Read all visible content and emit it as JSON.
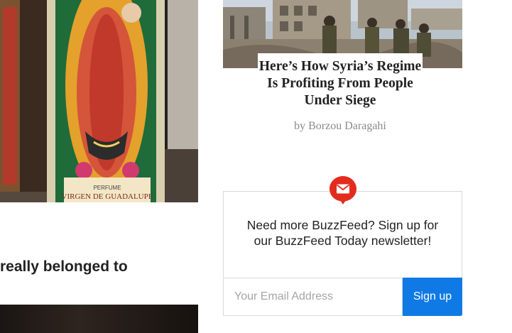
{
  "left_column": {
    "headline_fragment": "really belonged to",
    "candle_label_text": "VIRGEN DE GUADALUPE",
    "candle_tag_text": "PERFUME"
  },
  "story": {
    "title": "Here’s How Syria’s Regime Is Profiting From People Under Siege",
    "byline": "by Borzou Daragahi"
  },
  "newsletter": {
    "prompt": "Need more BuzzFeed? Sign up for our BuzzFeed Today newsletter!",
    "email_placeholder": "Your Email Address",
    "signup_label": "Sign up"
  },
  "colors": {
    "accent_blue": "#0f7ae5",
    "badge_red": "#e32c1e",
    "border": "#d9d9d9",
    "byline_gray": "#8a8a8a"
  },
  "icons": {
    "newsletter_badge": "envelope-icon"
  }
}
